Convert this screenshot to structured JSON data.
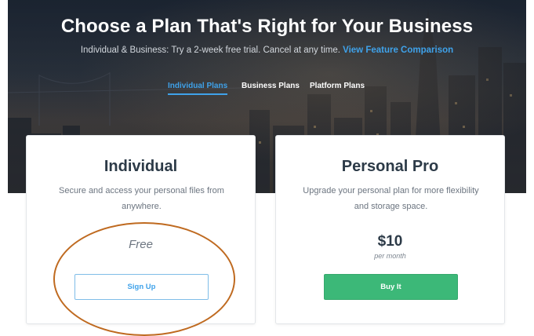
{
  "hero": {
    "title": "Choose a Plan That's Right for Your Business",
    "subtitle": "Individual & Business: Try a 2-week free trial. Cancel at any time.",
    "subtitle_link": "View Feature Comparison"
  },
  "tabs": [
    {
      "label": "Individual Plans",
      "active": true
    },
    {
      "label": "Business Plans",
      "active": false
    },
    {
      "label": "Platform Plans",
      "active": false
    }
  ],
  "plans": [
    {
      "title": "Individual",
      "description": "Secure and access your personal files from anywhere.",
      "price": "Free",
      "button_label": "Sign Up"
    },
    {
      "title": "Personal Pro",
      "description": "Upgrade your personal plan for more flexibility and storage space.",
      "price": "$10",
      "price_period": "per month",
      "button_label": "Buy It"
    }
  ],
  "colors": {
    "accent_blue": "#3fa2ea",
    "buy_green": "#3cb878",
    "annotation_orange": "#bf6a20",
    "heading_dark": "#2c3a47"
  }
}
